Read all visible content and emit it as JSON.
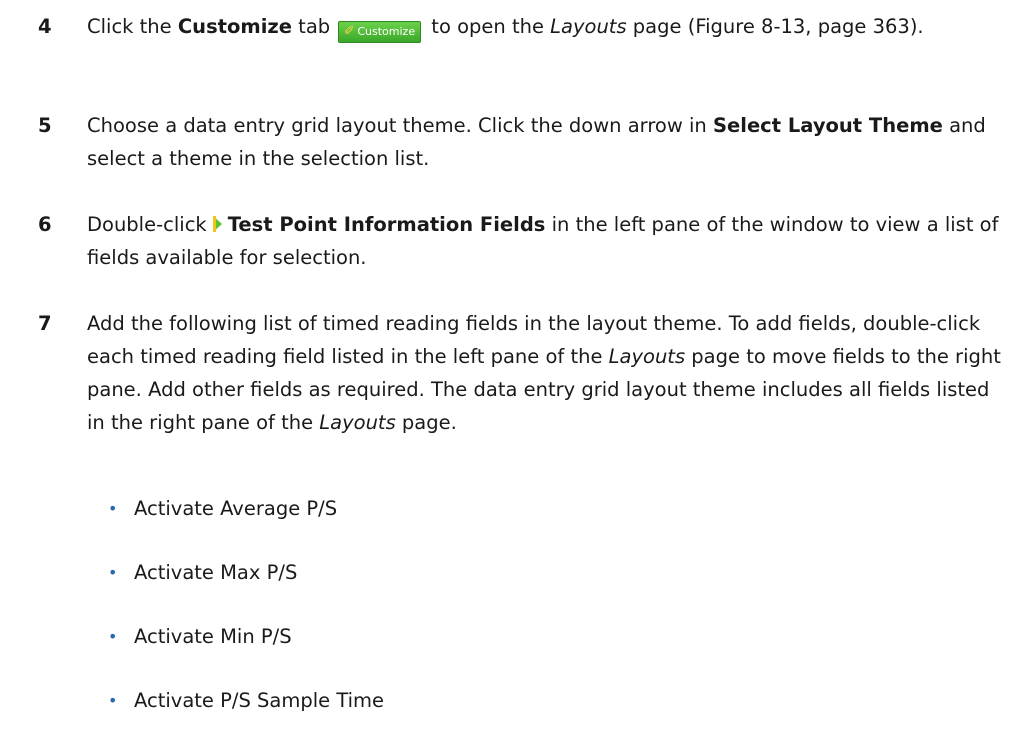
{
  "steps": [
    {
      "number": "4",
      "t1": "Click the ",
      "b1": "Customize",
      "t2": " tab",
      "tab_icon": "wrench-icon",
      "tab_label": "Customize",
      "t3": " to open the ",
      "i1": "Layouts",
      "t4": " page (Figure 8-13, page 363)."
    },
    {
      "number": "5",
      "t1": "Choose a data entry grid layout theme. Click the down arrow in ",
      "b1": "Select Layout Theme",
      "t2": " and select a theme in the selection list."
    },
    {
      "number": "6",
      "t1": "Double-click",
      "arrow_icon": "expand-arrow-icon",
      "b1": "Test Point Information Fields",
      "t2": " in the left pane of the window to view a list of fields available for selection."
    },
    {
      "number": "7",
      "t1": "Add the following list of timed reading fields in the layout theme. To add fields, double-click each timed reading field listed in the left pane of the ",
      "i1": "Layouts",
      "t2": " page to move fields to the right pane. Add other fields as required. The data entry grid layout theme includes all fields listed in the right pane of the ",
      "i2": "Layouts",
      "t3": " page."
    }
  ],
  "bullets": [
    "Activate Average P/S",
    "Activate Max P/S",
    "Activate Min P/S",
    "Activate P/S Sample Time"
  ],
  "bullet_symbol": "•",
  "colors": {
    "text": "#1a1a1a",
    "bullet": "#2b6cb0",
    "tab_green": "#3aa82a"
  }
}
